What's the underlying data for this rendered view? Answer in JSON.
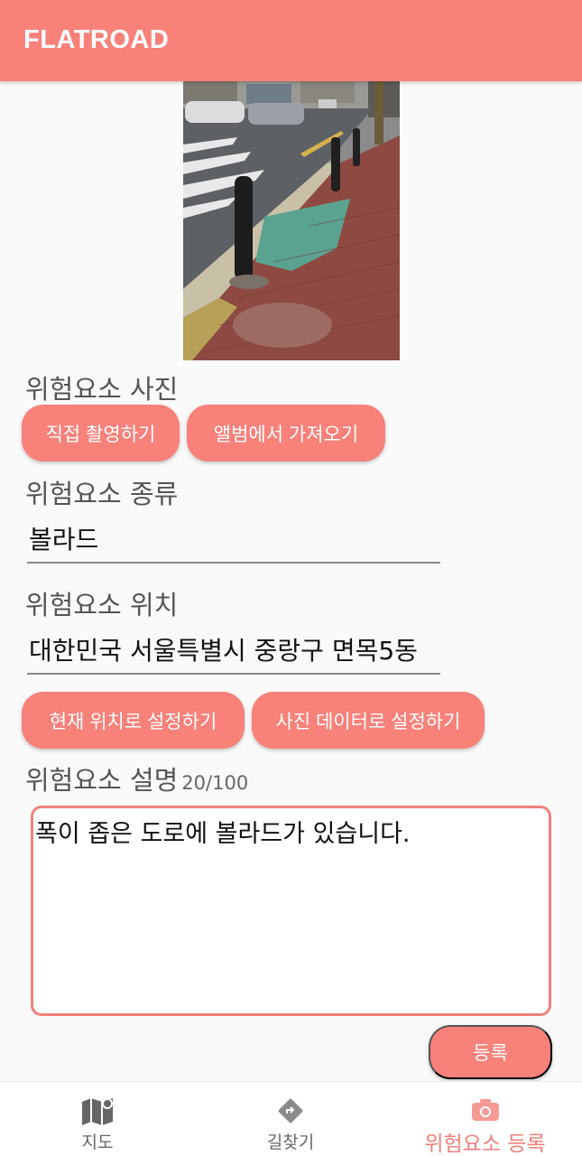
{
  "appbar": {
    "title": "FLATROAD"
  },
  "photo_section": {
    "label": "위험요소 사진",
    "camera_button": "직접 촬영하기",
    "album_button": "앨범에서 가져오기"
  },
  "type_section": {
    "label": "위험요소 종류",
    "value": "볼라드"
  },
  "location_section": {
    "label": "위험요소 위치",
    "value": "대한민국 서울특별시 중랑구 면목5동",
    "current_location_button": "현재 위치로 설정하기",
    "photo_data_button": "사진 데이터로 설정하기"
  },
  "description_section": {
    "label": "위험요소 설명",
    "counter": "20/100",
    "value": "폭이 좁은 도로에 볼라드가 있습니다."
  },
  "submit_button": "등록",
  "bottom_nav": {
    "items": [
      {
        "label": "지도",
        "icon": "map-icon"
      },
      {
        "label": "길찾기",
        "icon": "directions-icon"
      },
      {
        "label": "위험요소 등록",
        "icon": "camera-icon",
        "active": true
      }
    ]
  },
  "colors": {
    "accent": "#f8817a",
    "accent_text": "#f0807a"
  }
}
